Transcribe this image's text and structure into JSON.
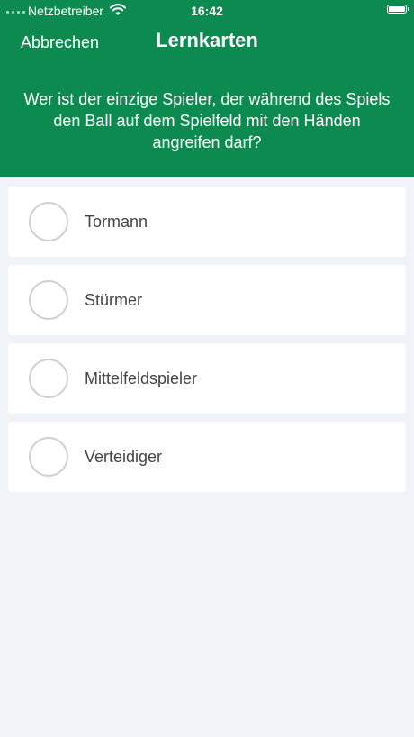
{
  "status_bar": {
    "carrier": "Netzbetreiber",
    "time": "16:42",
    "wifi_icon": "wifi-icon",
    "battery_icon": "battery-icon"
  },
  "nav": {
    "cancel_label": "Abbrechen",
    "title": "Lernkarten"
  },
  "question": {
    "text": "Wer ist der einzige Spieler, der während des Spiels den Ball auf dem Spielfeld mit den Händen angreifen darf?"
  },
  "options": [
    {
      "label": "Tormann"
    },
    {
      "label": "Stürmer"
    },
    {
      "label": "Mittelfeldspieler"
    },
    {
      "label": "Verteidiger"
    }
  ],
  "colors": {
    "header_bg": "#0d8a4f",
    "page_bg": "#f0f3f7",
    "card_bg": "#ffffff",
    "radio_border": "#cfcfcf",
    "option_text": "#444444"
  }
}
